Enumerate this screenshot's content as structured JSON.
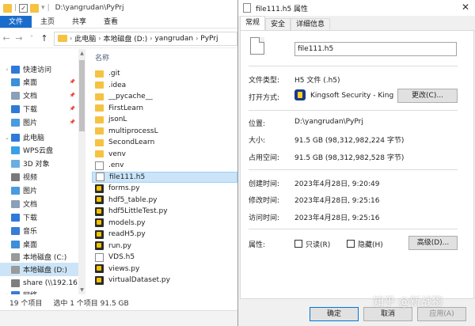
{
  "explorer": {
    "window_title": "D:\\yangrudan\\PyPrj",
    "ribbon_tabs": [
      "文件",
      "主页",
      "共享",
      "查看"
    ],
    "breadcrumb": [
      "此电脑",
      "本地磁盘 (D:)",
      "yangrudan",
      "PyPrj"
    ],
    "column_header": "名称",
    "nav_items": [
      {
        "label": "快速访问",
        "icon": "star-icon",
        "color": "#2f7ad8",
        "pinned": false
      },
      {
        "label": "桌面",
        "icon": "desktop-icon",
        "color": "#3c8fd9",
        "pinned": true
      },
      {
        "label": "文档",
        "icon": "documents-icon",
        "color": "#8aa0b8",
        "pinned": true
      },
      {
        "label": "下载",
        "icon": "download-icon",
        "color": "#2f7ad8",
        "pinned": true
      },
      {
        "label": "图片",
        "icon": "pictures-icon",
        "color": "#4a9be0",
        "pinned": true
      },
      {
        "label": "此电脑",
        "icon": "pc-icon",
        "color": "#2f7ad8",
        "pinned": false
      },
      {
        "label": "WPS云盘",
        "icon": "cloud-icon",
        "color": "#3aa0e6",
        "pinned": false
      },
      {
        "label": "3D 对象",
        "icon": "3d-objects-icon",
        "color": "#6aaee0",
        "pinned": false
      },
      {
        "label": "视频",
        "icon": "video-icon",
        "color": "#7a7a7a",
        "pinned": false
      },
      {
        "label": "图片",
        "icon": "pictures-icon",
        "color": "#4a9be0",
        "pinned": false
      },
      {
        "label": "文档",
        "icon": "documents-icon",
        "color": "#8aa0b8",
        "pinned": false
      },
      {
        "label": "下载",
        "icon": "download-icon",
        "color": "#2f7ad8",
        "pinned": false
      },
      {
        "label": "音乐",
        "icon": "music-icon",
        "color": "#3a7bd5",
        "pinned": false
      },
      {
        "label": "桌面",
        "icon": "desktop-icon",
        "color": "#3c8fd9",
        "pinned": false
      },
      {
        "label": "本地磁盘 (C:)",
        "icon": "drive-icon",
        "color": "#9a9a9a",
        "pinned": false
      },
      {
        "label": "本地磁盘 (D:)",
        "icon": "drive-icon",
        "color": "#9a9a9a",
        "pinned": false
      },
      {
        "label": "share (\\\\192.16",
        "icon": "network-drive-icon",
        "color": "#7f7f7f",
        "pinned": false
      },
      {
        "label": "网络",
        "icon": "network-icon",
        "color": "#3a7bd5",
        "pinned": false
      }
    ],
    "selected_nav_index": 15,
    "files": [
      {
        "name": ".git",
        "type": "folder"
      },
      {
        "name": ".idea",
        "type": "folder"
      },
      {
        "name": "__pycache__",
        "type": "folder"
      },
      {
        "name": "FirstLearn",
        "type": "folder"
      },
      {
        "name": "jsonL",
        "type": "folder"
      },
      {
        "name": "multiprocessL",
        "type": "folder"
      },
      {
        "name": "SecondLearn",
        "type": "folder"
      },
      {
        "name": "venv",
        "type": "folder"
      },
      {
        "name": ".env",
        "type": "doc"
      },
      {
        "name": "file111.h5",
        "type": "doc"
      },
      {
        "name": "forms.py",
        "type": "py"
      },
      {
        "name": "hdf5_table.py",
        "type": "py"
      },
      {
        "name": "hdf5LittleTest.py",
        "type": "py"
      },
      {
        "name": "models.py",
        "type": "py"
      },
      {
        "name": "readH5.py",
        "type": "py"
      },
      {
        "name": "run.py",
        "type": "py"
      },
      {
        "name": "VDS.h5",
        "type": "doc"
      },
      {
        "name": "views.py",
        "type": "py"
      },
      {
        "name": "virtualDataset.py",
        "type": "py"
      }
    ],
    "selected_file_index": 9,
    "status": {
      "count": "19 个项目",
      "selection": "选中 1 个项目  91.5 GB"
    }
  },
  "dialog": {
    "title": "file111.h5 属性",
    "tabs": [
      "常规",
      "安全",
      "详细信息"
    ],
    "active_tab": 0,
    "filename": "file111.h5",
    "file_type_label": "文件类型:",
    "file_type_value": "H5 文件 (.h5)",
    "open_with_label": "打开方式:",
    "open_with_value": "Kingsoft Security - King",
    "change_button": "更改(C)...",
    "location_label": "位置:",
    "location_value": "D:\\yangrudan\\PyPrj",
    "size_label": "大小:",
    "size_value": "91.5 GB (98,312,982,224 字节)",
    "disk_size_label": "占用空间:",
    "disk_size_value": "91.5 GB (98,312,982,528 字节)",
    "created_label": "创建时间:",
    "created_value": "2023年4月28日, 9:20:49",
    "modified_label": "修改时间:",
    "modified_value": "2023年4月28日, 9:25:16",
    "accessed_label": "访问时间:",
    "accessed_value": "2023年4月28日, 9:25:16",
    "attributes_label": "属性:",
    "readonly_label": "只读(R)",
    "hidden_label": "隐藏(H)",
    "advanced_button": "高级(D)...",
    "ok_button": "确定",
    "cancel_button": "取消",
    "apply_button": "应用(A)"
  },
  "watermark": "知乎 @新战猕"
}
